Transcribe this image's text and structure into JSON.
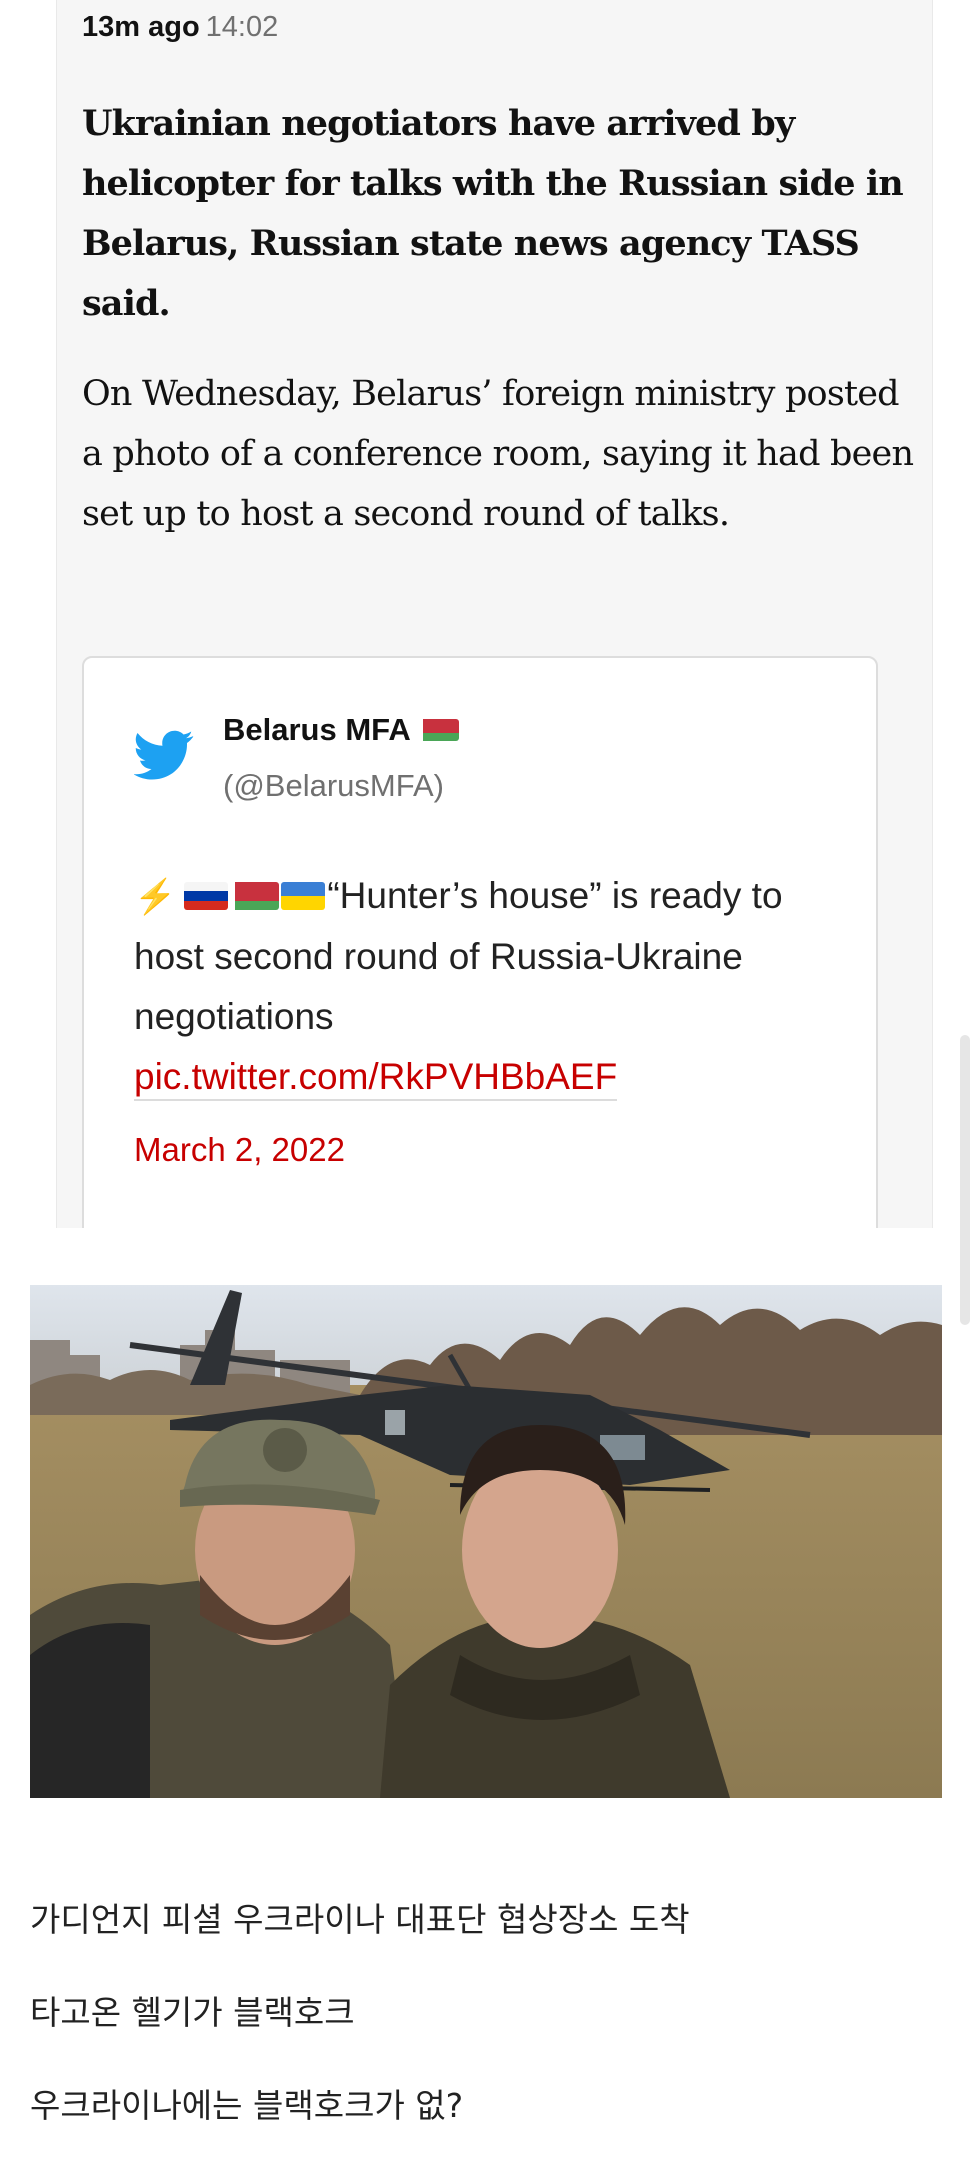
{
  "article": {
    "relative_time": "13m ago",
    "clock_time": "14:02",
    "headline": "Ukrainian negotiators have arrived by helicopter for talks with the Russian side in Belarus, Russian state news agency TASS said.",
    "body": "On Wednesday, Belarus’ foreign ministry posted a photo of a conference room, saying it had been set up to host a second round of talks."
  },
  "tweet": {
    "author": "Belarus MFA",
    "handle": "(@BelarusMFA)",
    "author_flag": "belarus-flag",
    "lead_icons": [
      "lightning-icon",
      "russia-flag",
      "belarus-flag",
      "ukraine-flag"
    ],
    "text": "“Hunter’s house” is ready to host second round of Russia-Ukraine negotiations",
    "link": "pic.twitter.com/RkPVHBbAEF",
    "date": "March 2, 2022",
    "link_color": "#c70000",
    "icon": "twitter-bird-icon",
    "icon_color": "#1da1f2"
  },
  "captions": {
    "line1": "가디언지 피셜 우크라이나 대표단 협상장소 도착",
    "line2": "타고온 헬기가 블랙호크",
    "line3": "우크라이나에는 블랙호크가 없?"
  }
}
